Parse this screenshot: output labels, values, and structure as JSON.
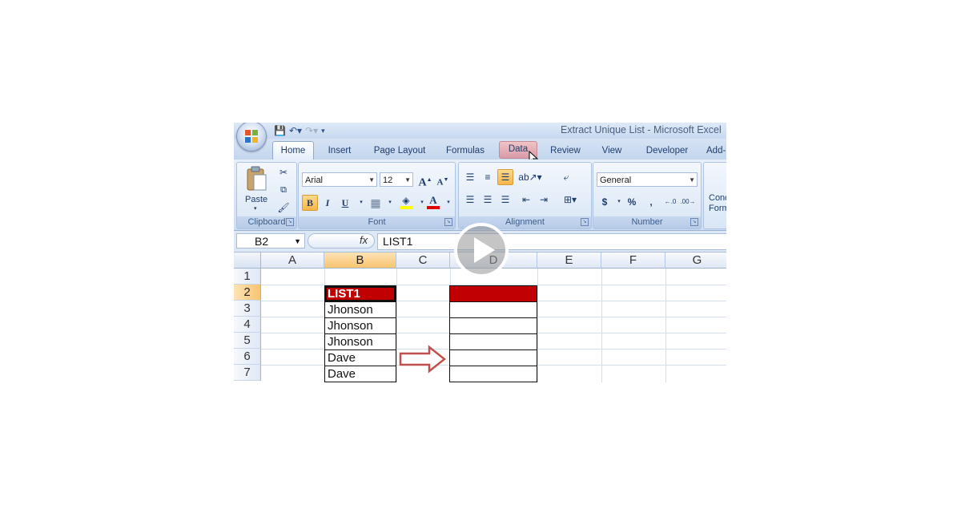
{
  "window": {
    "title": "Extract Unique List - Microsoft Excel"
  },
  "ribbon_tabs": [
    {
      "label": "Home",
      "state": "active"
    },
    {
      "label": "Insert",
      "state": "normal"
    },
    {
      "label": "Page Layout",
      "state": "normal"
    },
    {
      "label": "Formulas",
      "state": "normal"
    },
    {
      "label": "Data",
      "state": "hover"
    },
    {
      "label": "Review",
      "state": "normal"
    },
    {
      "label": "View",
      "state": "normal"
    },
    {
      "label": "Developer",
      "state": "normal"
    },
    {
      "label": "Add-Ins",
      "state": "normal"
    }
  ],
  "groups": {
    "clipboard": {
      "label": "Clipboard",
      "paste_label": "Paste"
    },
    "font": {
      "label": "Font",
      "font_name": "Arial",
      "font_size": "12"
    },
    "alignment": {
      "label": "Alignment"
    },
    "number": {
      "label": "Number",
      "format": "General",
      "currency": "$",
      "percent": "%",
      "comma": ","
    },
    "styles": {
      "partial_label": "Cond Form"
    }
  },
  "formula_bar": {
    "name_box": "B2",
    "fx_label": "fx",
    "content": "LIST1"
  },
  "columns": [
    "A",
    "B",
    "C",
    "D",
    "E",
    "F",
    "G"
  ],
  "rows": [
    "1",
    "2",
    "3",
    "4",
    "5",
    "6",
    "7"
  ],
  "list_b": [
    "LIST1",
    "Jhonson",
    "Jhonson",
    "Jhonson",
    "Dave",
    "Dave"
  ],
  "colors": {
    "header_fill": "#c00000",
    "arrow": "#c0504d",
    "selected_header": "#f8c46f"
  }
}
